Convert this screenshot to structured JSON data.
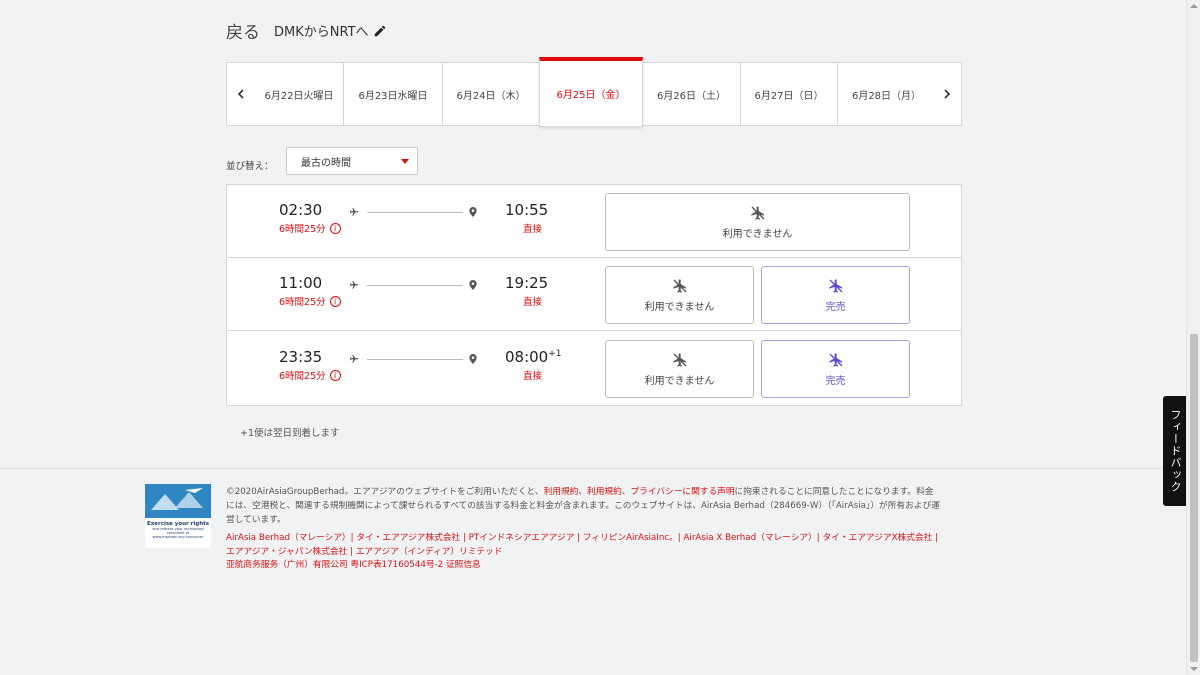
{
  "header": {
    "back_label": "戻る",
    "route_label": "DMKからNRTへ"
  },
  "dates": [
    {
      "label": "6月22日火曜日",
      "selected": false
    },
    {
      "label": "6月23日水曜日",
      "selected": false
    },
    {
      "label": "6月24日（木）",
      "selected": false
    },
    {
      "label": "6月25日（金）",
      "selected": true
    },
    {
      "label": "6月26日（土）",
      "selected": false
    },
    {
      "label": "6月27日（日）",
      "selected": false
    },
    {
      "label": "6月28日（月）",
      "selected": false
    }
  ],
  "sort": {
    "label": "並び替え：",
    "value": "最古の時間"
  },
  "flights": [
    {
      "depart": "02:30",
      "duration": "6時間25分",
      "arrive": "10:55",
      "arrive_suffix": "",
      "stops": "直接",
      "fares": [
        {
          "label": "利用できません",
          "status": "unavailable"
        }
      ]
    },
    {
      "depart": "11:00",
      "duration": "6時間25分",
      "arrive": "19:25",
      "arrive_suffix": "",
      "stops": "直接",
      "fares": [
        {
          "label": "利用できません",
          "status": "unavailable"
        },
        {
          "label": "完売",
          "status": "sold-out"
        }
      ]
    },
    {
      "depart": "23:35",
      "duration": "6時間25分",
      "arrive": "08:00",
      "arrive_suffix": "+1",
      "stops": "直接",
      "fares": [
        {
          "label": "利用できません",
          "status": "unavailable"
        },
        {
          "label": "完売",
          "status": "sold-out"
        }
      ]
    }
  ],
  "footnote": "+1便は翌日到着します",
  "footer": {
    "badge_title": "Exercise your rights",
    "badge_text": "and redress your unresolved complaint at www.mavcom.my/consumer",
    "legal_part1": "©2020AirAsiaGroupBerhad。エアアジアのウェブサイトをご利用いただくと、",
    "legal_link1": "利用規約",
    "legal_sep1": "、",
    "legal_link2": "利用規約",
    "legal_sep2": "、",
    "legal_link3": "プライバシーに関する声明",
    "legal_part2": "に拘束されることに同意したことになります。料金には、空港税と、関連する規制機関によって課せられるすべての該当する料金と料金が含まれます。このウェブサイトは、AirAsia Berhad（284669-W）（「AirAsia」）が所有および運営しています。",
    "companies": "AirAsia Berhad（マレーシア）| タイ・エアアジア株式会社 | PTインドネシアエアアジア | フィリピンAirAsiaInc。| AirAsia X Berhad（マレーシア）| タイ・エアアジアX株式会社 | エアアジア・ジャパン株式会社 | エアアジア（インディア）リミテッド",
    "icp": "亚航商务服务（广州）有限公司 粤ICP表17160544号-2 证照信息"
  },
  "feedback_label": "フィードバック",
  "colors": {
    "accent": "#e10a0a",
    "sold_out": "#5b4fd0"
  }
}
